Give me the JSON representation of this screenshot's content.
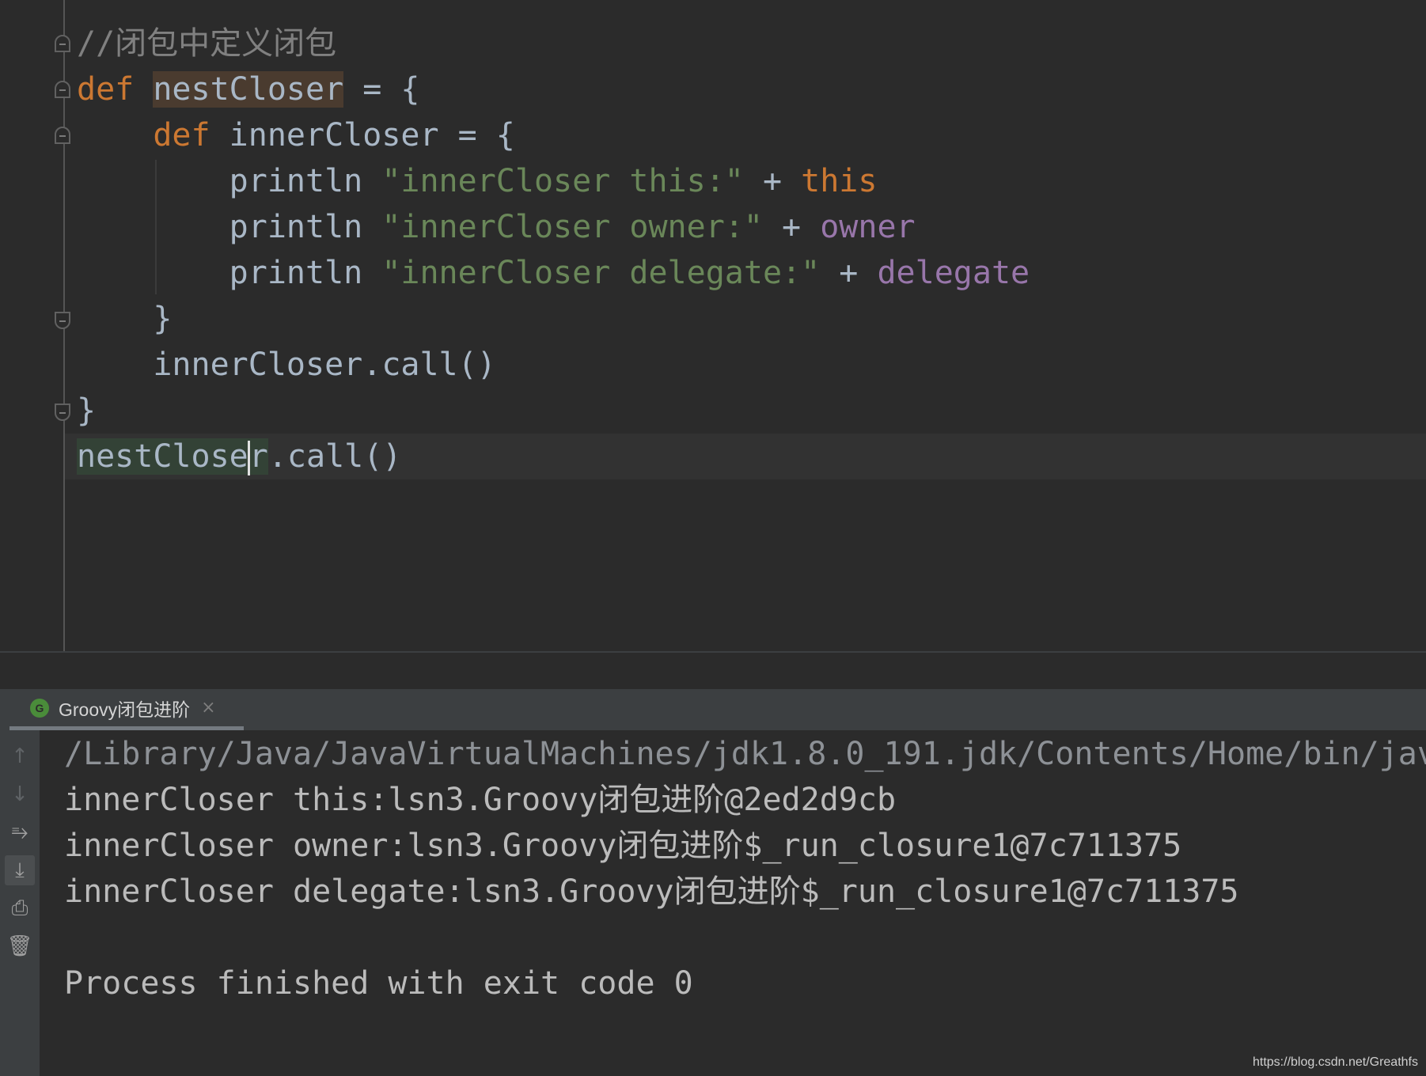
{
  "editor": {
    "lines": {
      "l1": {
        "comment": "//闭包中定义闭包"
      },
      "l2": {
        "kw": "def",
        "name": "nestCloser",
        "rest": " = {"
      },
      "l3": {
        "indent": "    ",
        "kw": "def",
        "rest": " innerCloser = {"
      },
      "l4": {
        "indent": "        ",
        "fn": "println ",
        "str": "\"innerCloser this:\"",
        "op": " + ",
        "ref": "this"
      },
      "l5": {
        "indent": "        ",
        "fn": "println ",
        "str": "\"innerCloser owner:\"",
        "op": " + ",
        "ref": "owner"
      },
      "l6": {
        "indent": "        ",
        "fn": "println ",
        "str": "\"innerCloser delegate:\"",
        "op": " + ",
        "ref": "delegate"
      },
      "l7": {
        "text": "    }"
      },
      "l8": {
        "text": "    innerCloser.call()"
      },
      "l9": {
        "text": "}"
      },
      "l10": {
        "name_before_caret": "nestClose",
        "name_after_caret": "r",
        "rest": ".call()"
      }
    }
  },
  "run_panel": {
    "tab_label": "Groovy闭包进阶",
    "tab_icon": "G",
    "close_glyph": "×",
    "toolbar": {
      "up": "↑",
      "down": "↓",
      "wrap": "⥱",
      "scroll_end": "⤓",
      "print": "⎙",
      "clear": "🗑"
    },
    "output": [
      "/Library/Java/JavaVirtualMachines/jdk1.8.0_191.jdk/Contents/Home/bin/jav",
      "innerCloser this:lsn3.Groovy闭包进阶@2ed2d9cb",
      "innerCloser owner:lsn3.Groovy闭包进阶$_run_closure1@7c711375",
      "innerCloser delegate:lsn3.Groovy闭包进阶$_run_closure1@7c711375",
      "",
      "Process finished with exit code 0"
    ]
  },
  "watermark": "https://blog.csdn.net/Greathfs",
  "colors": {
    "background": "#2b2b2b",
    "keyword": "#cc7832",
    "string": "#6a8759",
    "comment": "#808080",
    "field": "#9876aa",
    "text": "#a9b7c6"
  }
}
